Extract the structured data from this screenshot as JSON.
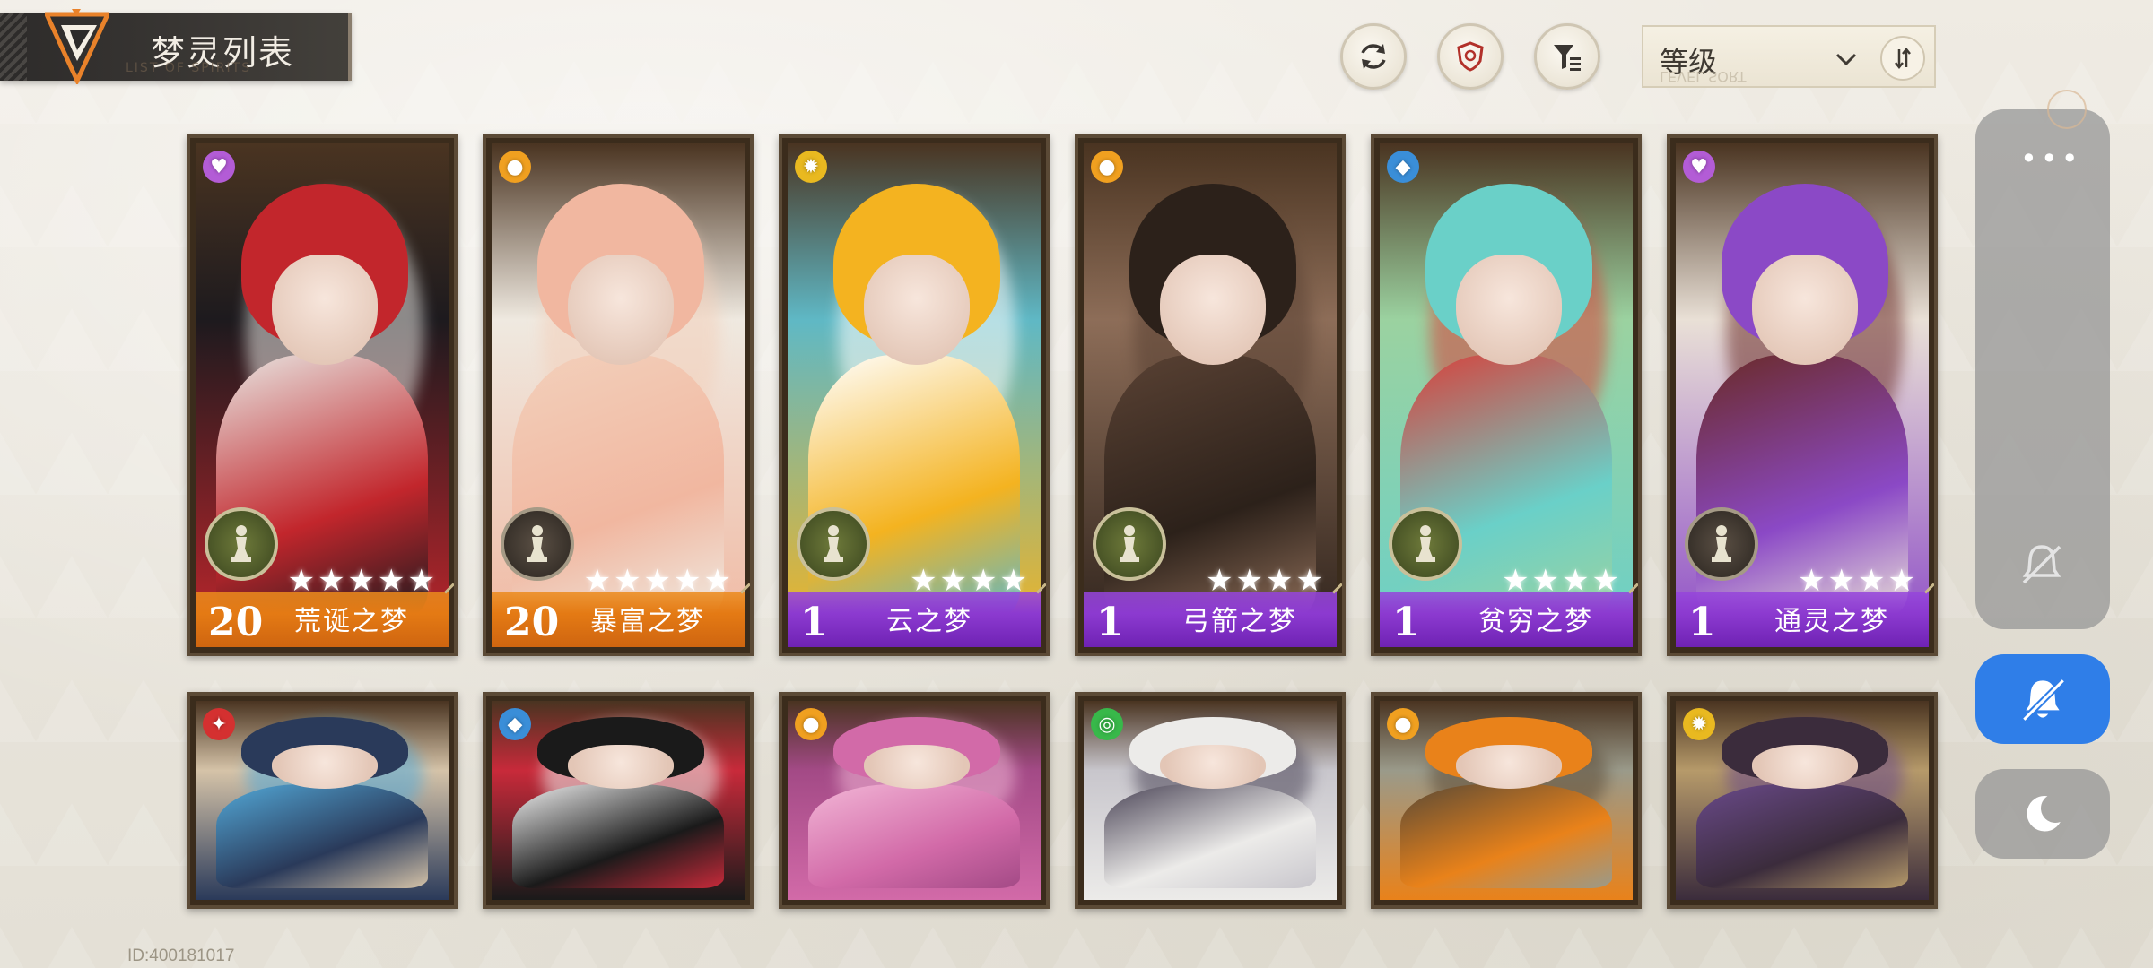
{
  "header": {
    "title": "梦灵列表",
    "subtitle_faint": "LIST OF SPIRITS",
    "sort_label": "等级",
    "sort_label_mirror": "LEVEL SORT"
  },
  "toolbar": {
    "refresh_icon": "refresh-icon",
    "shield_icon": "shield-icon",
    "filter_icon": "filter-icon",
    "sort_order_icon": "sort-order-icon"
  },
  "cards_row1": [
    {
      "level": "20",
      "name": "荒诞之梦",
      "stars": "★★★★★",
      "plate": "orange",
      "badge": "green",
      "element_icon": "heart-icon",
      "element_color": "#b35cd6",
      "element_glyph": "♥",
      "palette": [
        "#c2262c",
        "#e8e6e2",
        "#1d1a1e"
      ]
    },
    {
      "level": "20",
      "name": "暴富之梦",
      "stars": "★★★★★",
      "plate": "orange",
      "badge": "dark",
      "element_icon": "coin-icon",
      "element_color": "#f0a020",
      "element_glyph": "●",
      "palette": [
        "#f1b7a0",
        "#f3d0bb",
        "#efe9e0"
      ]
    },
    {
      "level": "1",
      "name": "云之梦",
      "stars": "★★★★",
      "plate": "purple",
      "badge": "green",
      "element_icon": "sun-icon",
      "element_color": "#e9b920",
      "element_glyph": "✹",
      "palette": [
        "#f4b320",
        "#ffffff",
        "#5fb8c5"
      ]
    },
    {
      "level": "1",
      "name": "弓箭之梦",
      "stars": "★★★★",
      "plate": "purple",
      "badge": "green",
      "element_icon": "coin-icon",
      "element_color": "#f0a020",
      "element_glyph": "●",
      "palette": [
        "#2c211a",
        "#5a4234",
        "#8d6d58"
      ]
    },
    {
      "level": "1",
      "name": "贫穷之梦",
      "stars": "★★★★",
      "plate": "purple",
      "badge": "green",
      "element_icon": "crystal-icon",
      "element_color": "#3a8ed8",
      "element_glyph": "◆",
      "palette": [
        "#6ad0c8",
        "#d8403a",
        "#9bd2a0"
      ]
    },
    {
      "level": "1",
      "name": "通灵之梦",
      "stars": "★★★★",
      "plate": "purple",
      "badge": "dark",
      "element_icon": "heart-icon",
      "element_color": "#b35cd6",
      "element_glyph": "♥",
      "palette": [
        "#8b49c6",
        "#6a2a26",
        "#e9e0d6"
      ]
    }
  ],
  "cards_row2": [
    {
      "element_icon": "flame-shield-icon",
      "element_color": "#d43030",
      "element_glyph": "✦",
      "palette": [
        "#2a3a5a",
        "#53a9d8",
        "#d5c3a8"
      ]
    },
    {
      "element_icon": "crystal-icon",
      "element_color": "#3a8ed8",
      "element_glyph": "◆",
      "palette": [
        "#1a1a1a",
        "#f0f0f0",
        "#c82a3a"
      ]
    },
    {
      "element_icon": "coin-icon",
      "element_color": "#f0a020",
      "element_glyph": "●",
      "palette": [
        "#d26aa8",
        "#f2b6d6",
        "#a34a86"
      ]
    },
    {
      "element_icon": "planet-icon",
      "element_color": "#38b84a",
      "element_glyph": "◎",
      "palette": [
        "#ecebe9",
        "#4a4456",
        "#c8c6cc"
      ]
    },
    {
      "element_icon": "coin-icon",
      "element_color": "#f0a020",
      "element_glyph": "●",
      "palette": [
        "#e9821a",
        "#5a4a36",
        "#9a9a8a"
      ]
    },
    {
      "element_icon": "sun-icon",
      "element_color": "#e9b920",
      "element_glyph": "✹",
      "palette": [
        "#3b2c3c",
        "#6a4a8a",
        "#b69a6a"
      ]
    }
  ],
  "side_panel": {
    "menu_dots": "•••",
    "mute_icon": "bell-off-icon",
    "dnd_icon": "bell-mute-icon",
    "night_icon": "moon-icon"
  },
  "footer": {
    "player_id": "ID:400181017"
  }
}
